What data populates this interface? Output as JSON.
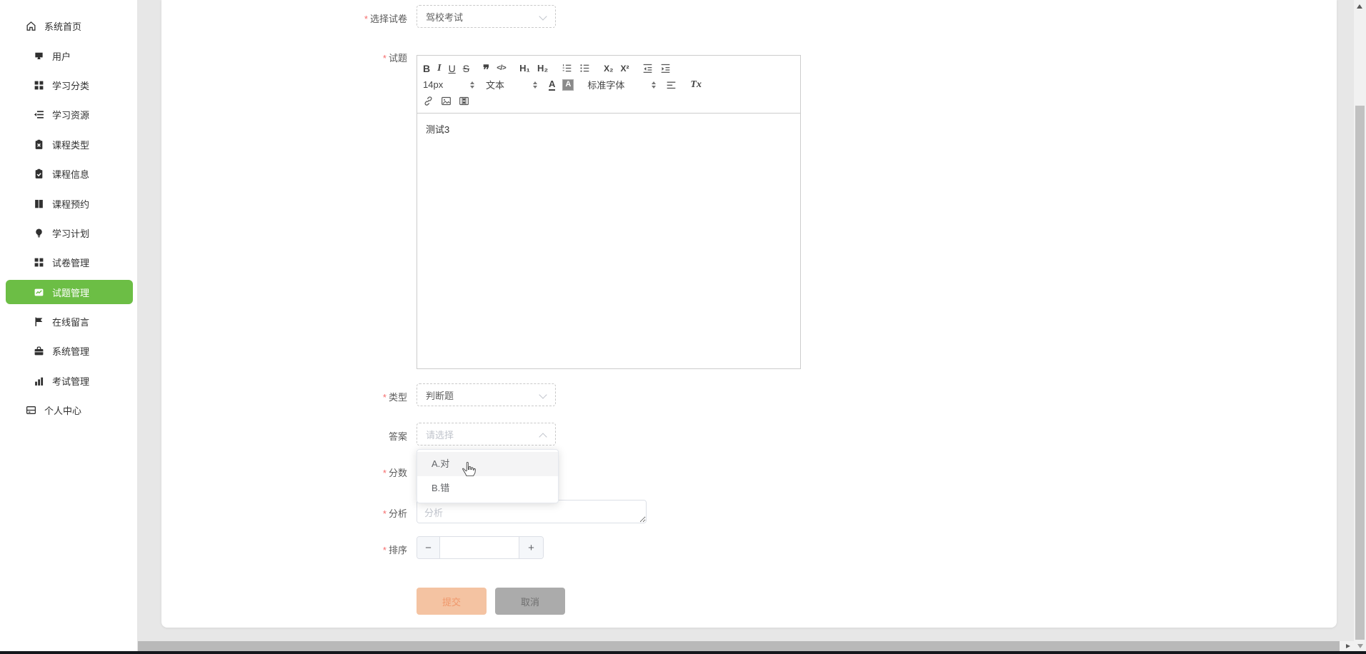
{
  "colors": {
    "accent_green": "#6cbe45",
    "submit_button_bg": "#f4c3a2",
    "cancel_button_bg": "#ababab",
    "asterisk_red": "#f56c6c"
  },
  "sidebar": {
    "items": [
      {
        "label": "系统首页",
        "icon": "home-icon",
        "active": false
      },
      {
        "label": "用户",
        "icon": "user-icon",
        "active": false
      },
      {
        "label": "学习分类",
        "icon": "grid-icon",
        "active": false
      },
      {
        "label": "学习资源",
        "icon": "list-icon",
        "active": false
      },
      {
        "label": "课程类型",
        "icon": "clipboard-x-icon",
        "active": false
      },
      {
        "label": "课程信息",
        "icon": "clipboard-check-icon",
        "active": false
      },
      {
        "label": "课程预约",
        "icon": "book-icon",
        "active": false
      },
      {
        "label": "学习计划",
        "icon": "bulb-icon",
        "active": false
      },
      {
        "label": "试卷管理",
        "icon": "grid-icon",
        "active": false
      },
      {
        "label": "试题管理",
        "icon": "trend-chart-icon",
        "active": true
      },
      {
        "label": "在线留言",
        "icon": "flag-icon",
        "active": false
      },
      {
        "label": "系统管理",
        "icon": "briefcase-icon",
        "active": false
      },
      {
        "label": "考试管理",
        "icon": "bar-chart-icon",
        "active": false
      },
      {
        "label": "个人中心",
        "icon": "panel-icon",
        "active": false
      }
    ]
  },
  "form": {
    "paper": {
      "label": "选择试卷",
      "required": true,
      "value": "驾校考试"
    },
    "question": {
      "label": "试题",
      "required": true,
      "content": "测试3"
    },
    "type": {
      "label": "类型",
      "required": true,
      "value": "判断题"
    },
    "answer": {
      "label": "答案",
      "required": false,
      "placeholder": "请选择",
      "options": [
        {
          "label": "A.对",
          "state": "hover"
        },
        {
          "label": "B.错",
          "state": "normal"
        }
      ]
    },
    "score": {
      "label": "分数",
      "required": true,
      "value": ""
    },
    "analysis": {
      "label": "分析",
      "required": true,
      "placeholder": "分析",
      "value": ""
    },
    "sort": {
      "label": "排序",
      "required": true,
      "value": ""
    },
    "asterisk": "*",
    "buttons": {
      "submit": "提交",
      "cancel": "取消"
    }
  },
  "editor": {
    "toolbar": {
      "bold": "B",
      "italic": "I",
      "underline": "U",
      "strike": "S",
      "blockquote": "❞",
      "code": "</>",
      "h1": "H₁",
      "h2": "H₂",
      "subscript": "X₂",
      "superscript": "X²",
      "size_value": "14px",
      "header_value": "文本",
      "color": "A",
      "background": "A",
      "font_value": "标准字体",
      "clean": "Tx"
    },
    "content": "测试3"
  }
}
